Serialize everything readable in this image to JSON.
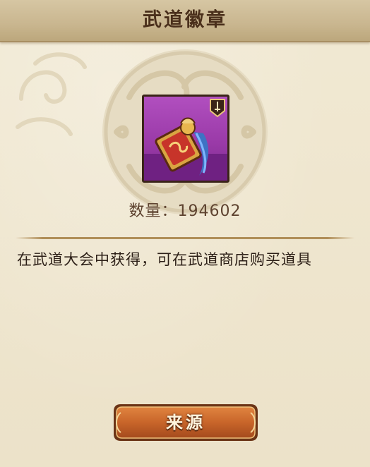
{
  "dialog": {
    "title": "武道徽章",
    "count_label": "数量：",
    "count_value": "194602",
    "description": "在武道大会中获得，可在武道商店购买道具",
    "source_button_label": "来源"
  },
  "colors": {
    "title_text": "#4a2f1b",
    "icon_bg": "#9a3aa8",
    "button": "#c8652a",
    "accent_gold": "#d9a441"
  },
  "icons": {
    "item": "martial-badge-icon",
    "rank": "sword-rank-icon"
  }
}
